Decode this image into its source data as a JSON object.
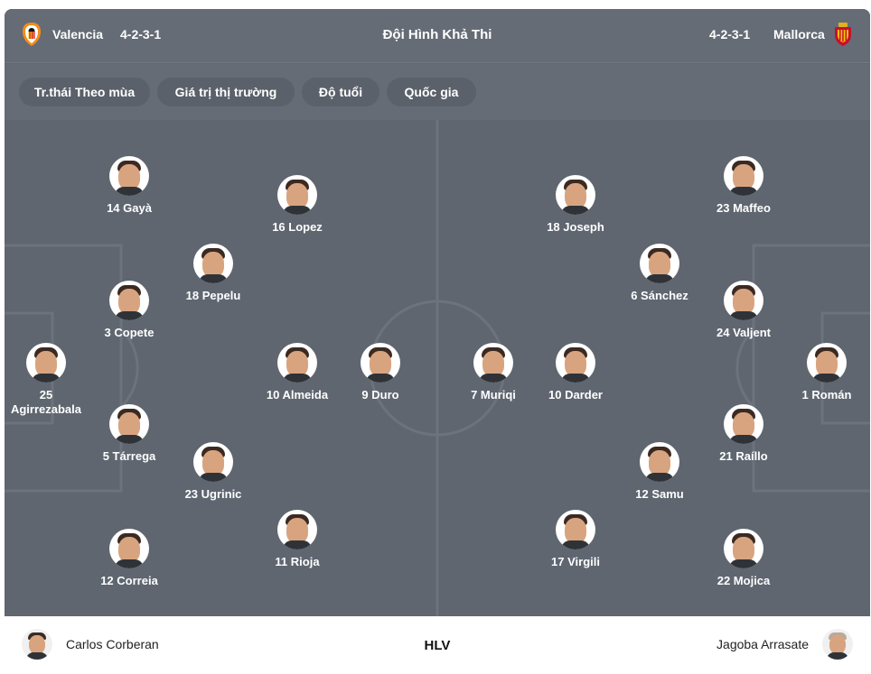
{
  "header": {
    "home_team": "Valencia",
    "home_formation": "4-2-3-1",
    "title": "Đội Hình Khả Thi",
    "away_formation": "4-2-3-1",
    "away_team": "Mallorca"
  },
  "tabs": [
    {
      "label": "Tr.thái Theo mùa"
    },
    {
      "label": "Giá trị thị trường"
    },
    {
      "label": "Độ tuổi"
    },
    {
      "label": "Quốc gia"
    }
  ],
  "home_players": [
    {
      "label": "14 Gayà"
    },
    {
      "label": "16 Lopez"
    },
    {
      "label": "18 Pepelu"
    },
    {
      "label": "3 Copete"
    },
    {
      "label": "25 Agirrezabala"
    },
    {
      "label": "10 Almeida"
    },
    {
      "label": "9 Duro"
    },
    {
      "label": "5 Tárrega"
    },
    {
      "label": "23 Ugrinic"
    },
    {
      "label": "12 Correia"
    },
    {
      "label": "11 Rioja"
    }
  ],
  "away_players": [
    {
      "label": "18 Joseph"
    },
    {
      "label": "23 Maffeo"
    },
    {
      "label": "6 Sánchez"
    },
    {
      "label": "24 Valjent"
    },
    {
      "label": "7 Muriqi"
    },
    {
      "label": "10 Darder"
    },
    {
      "label": "1 Román"
    },
    {
      "label": "21 Raíllo"
    },
    {
      "label": "12 Samu"
    },
    {
      "label": "17 Virgili"
    },
    {
      "label": "22 Mojica"
    }
  ],
  "footer": {
    "home_coach": "Carlos Corberan",
    "label": "HLV",
    "away_coach": "Jagoba Arrasate"
  },
  "colors": {
    "pitch": "#5f6670",
    "header": "#656c76",
    "tab_bg": "#5b616a",
    "valencia_crest": "#f28c1e",
    "mallorca_crest": "#c8102e"
  }
}
